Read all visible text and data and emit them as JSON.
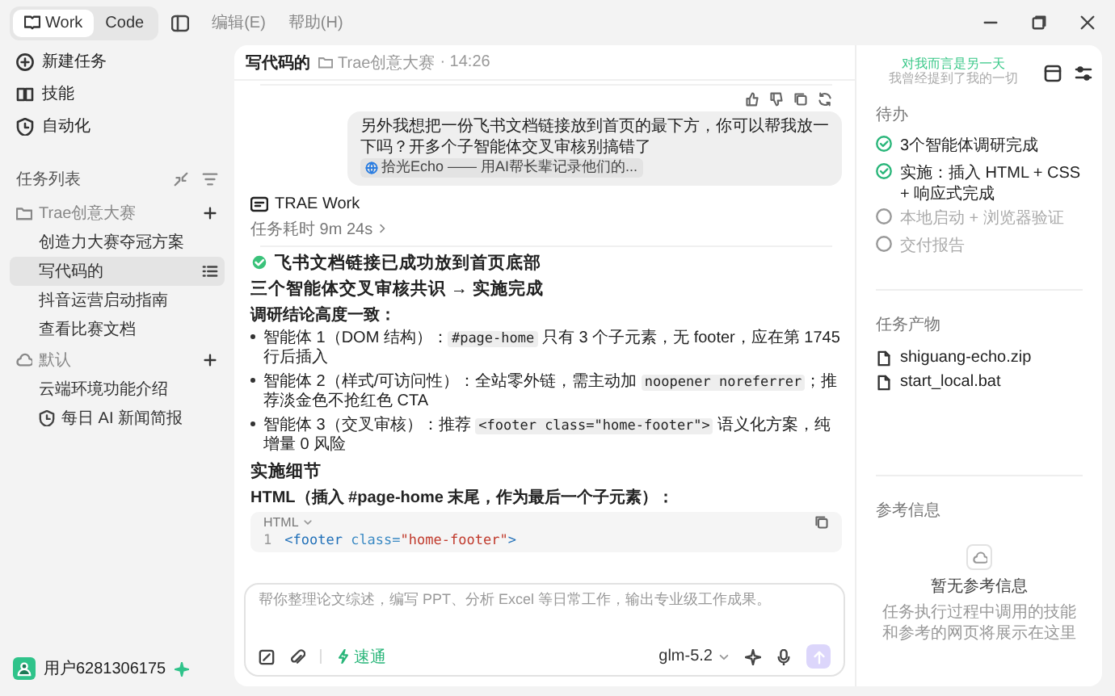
{
  "app_bar": {
    "modes": [
      {
        "label": "Work",
        "selected": true
      },
      {
        "label": "Code",
        "selected": false
      }
    ],
    "menus": [
      "编辑(E)",
      "帮助(H)"
    ]
  },
  "sidebar": {
    "nav": [
      {
        "kind": "new",
        "label": "新建任务"
      },
      {
        "kind": "skills",
        "label": "技能"
      },
      {
        "kind": "automation",
        "label": "自动化"
      }
    ],
    "task_list_title": "任务列表",
    "groups": [
      {
        "kind": "folder",
        "name": "Trae创意大赛",
        "children": [
          {
            "label": "创造力大赛夺冠方案",
            "selected": false,
            "scheduled": false
          },
          {
            "label": "写代码的",
            "selected": true,
            "scheduled": false
          },
          {
            "label": "抖音运营启动指南",
            "selected": false,
            "scheduled": false
          },
          {
            "label": "查看比赛文档",
            "selected": false,
            "scheduled": false
          }
        ]
      },
      {
        "kind": "cloud",
        "name": "默认",
        "children": [
          {
            "label": "云端环境功能介绍",
            "selected": false,
            "scheduled": false
          },
          {
            "label": "每日 AI 新闻简报",
            "selected": false,
            "scheduled": true
          }
        ]
      }
    ],
    "user": {
      "name": "用户6281306175"
    }
  },
  "chat": {
    "title": "写代码的",
    "folder": "Trae创意大赛",
    "time": "· 14:26",
    "user_message": {
      "text": "另外我想把一份飞书文档链接放到首页的最下方，你可以帮我放一下吗？开多个子智能体交叉审核别搞错了",
      "link": "拾光Echo —— 用AI帮长辈记录他们的..."
    },
    "agent": {
      "name": "TRAE Work",
      "duration": "任务耗时 9m 24s",
      "blocks": [
        {
          "kind": "check-heading",
          "text": "飞书文档链接已成功放到首页底部"
        },
        {
          "kind": "heading",
          "text": "三个智能体交叉审核共识 → 实施完成"
        },
        {
          "kind": "strong",
          "text": "调研结论高度一致："
        },
        {
          "kind": "bullet",
          "parts": [
            {
              "text": "智能体 1（DOM 结构）："
            },
            {
              "code": "#page-home"
            },
            {
              "text": " 只有 3 个子元素，无 footer，应在第 1745 行后插入"
            }
          ]
        },
        {
          "kind": "bullet",
          "parts": [
            {
              "text": "智能体 2（样式/可访问性）：全站零外链，需主动加 "
            },
            {
              "code": "noopener noreferrer"
            },
            {
              "text": "；推荐淡金色不抢红色 CTA"
            }
          ]
        },
        {
          "kind": "bullet",
          "parts": [
            {
              "text": "智能体 3（交叉审核）：推荐 "
            },
            {
              "code": "<footer class=\"home-footer\">"
            },
            {
              "text": " 语义化方案，纯增量 0 风险"
            }
          ]
        },
        {
          "kind": "heading",
          "text": "实施细节"
        },
        {
          "kind": "strong",
          "text": "HTML（插入 #page-home 末尾，作为最后一个子元素）："
        },
        {
          "kind": "code",
          "language": "HTML",
          "lines": [
            {
              "number": "1",
              "tokens": [
                {
                  "kind": "tag",
                  "s": "<footer"
                },
                {
                  "kind": "attr",
                  "s": " class="
                },
                {
                  "kind": "str",
                  "s": "\"home-footer\""
                },
                {
                  "kind": "tag",
                  "s": ">"
                }
              ]
            }
          ]
        }
      ]
    }
  },
  "composer": {
    "placeholder": "帮你整理论文综述，编写 PPT、分析 Excel 等日常工作，输出专业级工作成果。",
    "mode": "速通",
    "model": "glm-5.2",
    "send_disabled": true
  },
  "right_panel": {
    "quote": "对我而言是另一天",
    "quote_sub": "我曾经提到了我的一切",
    "todo_title": "待办",
    "todos": [
      {
        "label": "3个智能体调研完成",
        "checked": true
      },
      {
        "label": "实施：插入 HTML + CSS + 响应式完成",
        "checked": true
      },
      {
        "label": "本地启动 + 浏览器验证",
        "checked": false
      },
      {
        "label": "交付报告",
        "checked": false
      }
    ],
    "outputs_title": "任务产物",
    "outputs": [
      "shiguang-echo.zip",
      "start_local.bat"
    ],
    "reference_title": "参考信息",
    "reference_empty": "暂无参考信息",
    "reference_hint": "任务执行过程中调用的技能和参考的网页将展示在这里"
  }
}
